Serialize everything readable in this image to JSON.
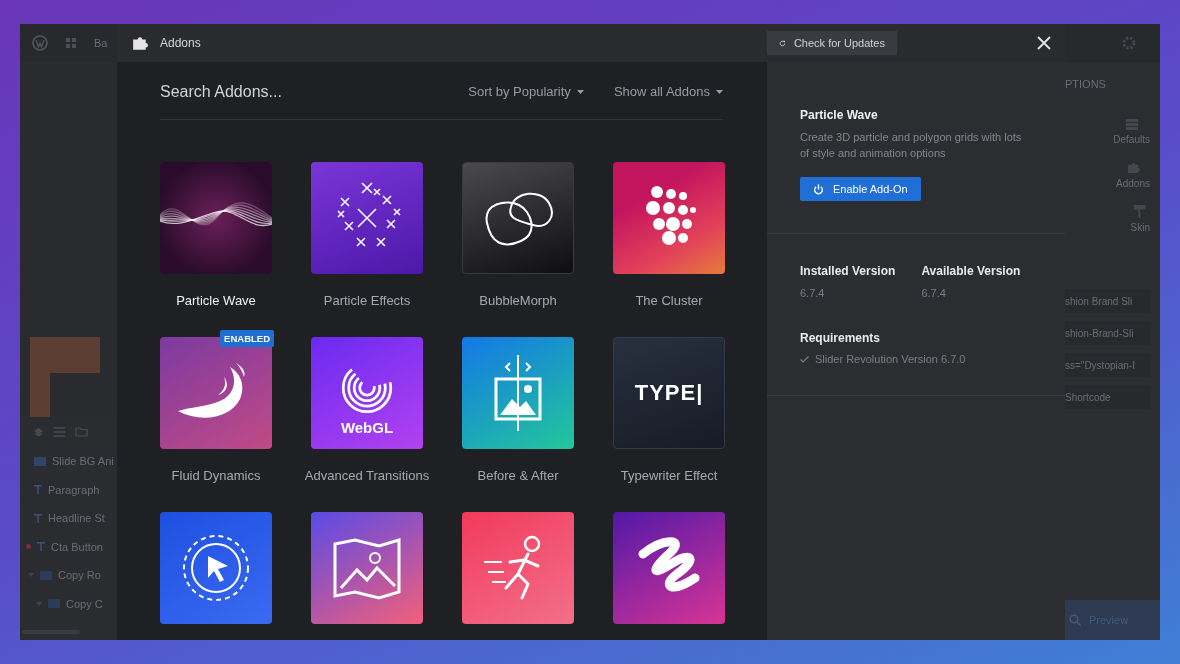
{
  "backdrop": {
    "top_bar_text": "Ba",
    "layers": [
      {
        "label": "Slide BG Ani",
        "kind": "image",
        "flagged": false
      },
      {
        "label": "Paragraph",
        "kind": "text",
        "flagged": false
      },
      {
        "label": "Headline St",
        "kind": "text",
        "flagged": false
      },
      {
        "label": "Cta Button",
        "kind": "text",
        "flagged": true
      },
      {
        "label": "Copy Ro",
        "kind": "row",
        "flagged": false,
        "expanded": true,
        "children": [
          {
            "label": "Copy C",
            "kind": "column",
            "flagged": false,
            "expanded": true
          }
        ]
      }
    ],
    "options_heading": "PTIONS",
    "option_buttons": [
      {
        "label": "Defaults",
        "kind": "defaults"
      },
      {
        "label": "Addons",
        "kind": "addons"
      },
      {
        "label": "Skin",
        "kind": "skin"
      }
    ],
    "fields": [
      "shion Brand Sli",
      "shion-Brand-Sli",
      "ss=\"Dystopian-I",
      "Shortcode"
    ],
    "preview_button": "Preview"
  },
  "modal": {
    "title": "Addons",
    "check_updates": "Check for Updates",
    "search": {
      "placeholder": "Search Addons..."
    },
    "sort": "Sort by Popularity",
    "filter": "Show all Addons",
    "addons": [
      {
        "name": "Particle Wave",
        "kind": "wave",
        "selected": true
      },
      {
        "name": "Particle Effects",
        "kind": "particles",
        "selected": false
      },
      {
        "name": "BubbleMorph",
        "kind": "blob",
        "selected": false
      },
      {
        "name": "The Cluster",
        "kind": "dots",
        "selected": false
      },
      {
        "name": "Fluid Dynamics",
        "kind": "fluid",
        "selected": false,
        "badge": "ENABLED"
      },
      {
        "name": "Advanced Transitions",
        "kind": "webgl",
        "selected": false,
        "icon_text": "WebGL"
      },
      {
        "name": "Before & After",
        "kind": "frame",
        "selected": false
      },
      {
        "name": "Typewriter Effect",
        "kind": "type",
        "selected": false,
        "icon_text": "TYPE|"
      },
      {
        "kind": "cursor"
      },
      {
        "kind": "landscape"
      },
      {
        "kind": "runner"
      },
      {
        "kind": "scribble"
      }
    ],
    "details": {
      "title": "Particle Wave",
      "description": "Create 3D particle and polygon grids with lots of style and animation options",
      "enable_button": "Enable Add-On",
      "versions": [
        {
          "label": "Installed Version",
          "value": "6.7.4"
        },
        {
          "label": "Available Version",
          "value": "6.7.4"
        }
      ],
      "requirements_heading": "Requirements",
      "requirements": [
        {
          "label": "Slider Revolution Version 6.7.0",
          "met": true
        }
      ]
    }
  }
}
